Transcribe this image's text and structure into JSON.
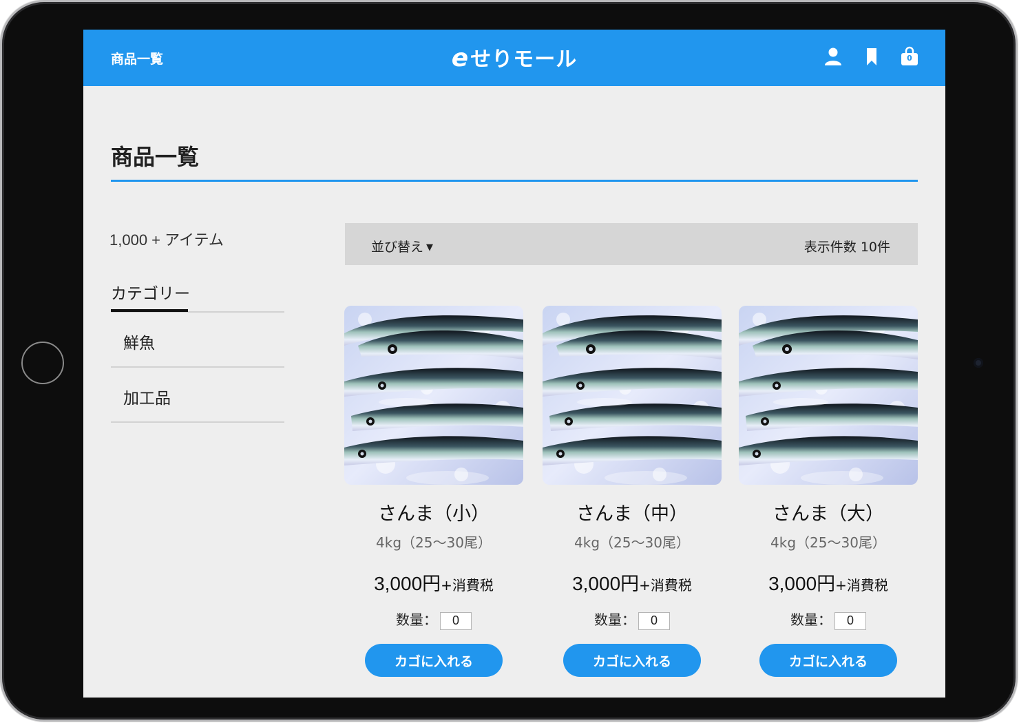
{
  "header": {
    "nav_label": "商品一覧",
    "brand_mark": "e",
    "brand_name": "せりモール",
    "cart_count": "0",
    "icons": [
      "user-icon",
      "bookmark-icon",
      "shopping-bag-icon"
    ],
    "color": "#2196ee"
  },
  "page": {
    "title": "商品一覧"
  },
  "sidebar": {
    "item_count": "1,000 + アイテム",
    "category_heading": "カテゴリー",
    "categories": [
      {
        "label": "鮮魚"
      },
      {
        "label": "加工品"
      }
    ]
  },
  "toolbar": {
    "sort_label": "並び替え",
    "per_page_label": "表示件数 10件"
  },
  "products": [
    {
      "name": "さんま（小）",
      "spec": "4kg（25〜30尾）",
      "price": "3,000",
      "currency": "円",
      "tax": "+消費税",
      "qty_label": "数量：",
      "qty": "0",
      "button": "カゴに入れる"
    },
    {
      "name": "さんま（中）",
      "spec": "4kg（25〜30尾）",
      "price": "3,000",
      "currency": "円",
      "tax": "+消費税",
      "qty_label": "数量：",
      "qty": "0",
      "button": "カゴに入れる"
    },
    {
      "name": "さんま（大）",
      "spec": "4kg（25〜30尾）",
      "price": "3,000",
      "currency": "円",
      "tax": "+消費税",
      "qty_label": "数量：",
      "qty": "0",
      "button": "カゴに入れる"
    }
  ]
}
